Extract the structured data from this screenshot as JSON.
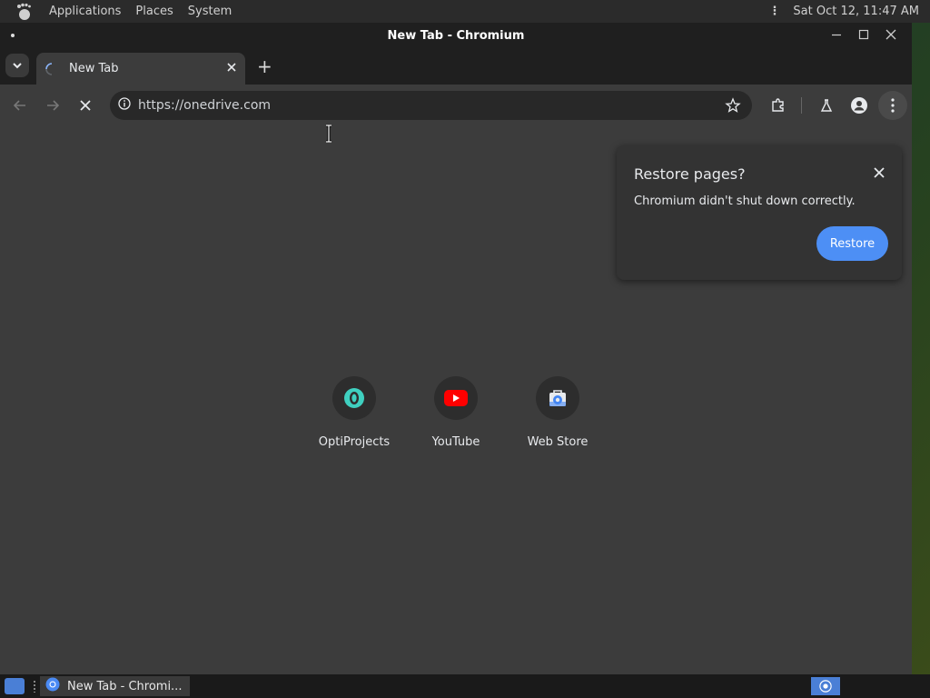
{
  "top_panel": {
    "menus": [
      "Applications",
      "Places",
      "System"
    ],
    "clock": "Sat Oct 12, 11:47 AM"
  },
  "window": {
    "title": "New Tab - Chromium",
    "tab": {
      "title": "New Tab"
    },
    "omnibox": {
      "url": "https://onedrive.com"
    }
  },
  "shortcuts": [
    {
      "label": "OptiProjects",
      "icon": "optiprojects-icon"
    },
    {
      "label": "YouTube",
      "icon": "youtube-icon"
    },
    {
      "label": "Web Store",
      "icon": "webstore-icon"
    }
  ],
  "restore_bubble": {
    "title": "Restore pages?",
    "message": "Chromium didn't shut down correctly.",
    "button": "Restore"
  },
  "taskbar": {
    "item": "New Tab - Chromi..."
  },
  "colors": {
    "accent": "#4d8ff5",
    "window_bg": "#3c3c3c",
    "titlebar": "#1f1f1f"
  }
}
